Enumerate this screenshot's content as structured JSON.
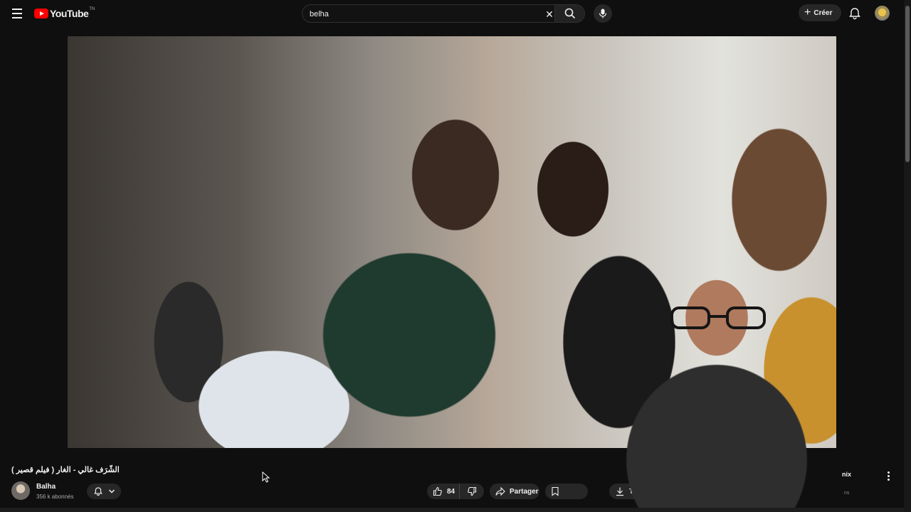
{
  "header": {
    "logo_text": "YouTube",
    "logo_tm": "TN",
    "search_value": "belha",
    "create_label": "Créer"
  },
  "video": {
    "title": "الشّرَف غالي - الغار ( فيلم قصير )",
    "channel_name": "Balha",
    "subscribers": "356 k abonnés",
    "like_count": "84",
    "share_label": "Partager",
    "download_label": "Té"
  },
  "side": {
    "mix_label": "nix",
    "mix_sub": "ns"
  },
  "colors": {
    "background": "#0f0f0f",
    "pill": "#272727",
    "brand_red": "#ff0000"
  },
  "icons": [
    "menu-icon",
    "youtube-logo-icon",
    "clear-icon",
    "search-icon",
    "mic-icon",
    "plus-icon",
    "bell-icon",
    "like-icon",
    "dislike-icon",
    "share-icon",
    "download-icon",
    "more-vert-icon",
    "chevron-down-icon"
  ]
}
